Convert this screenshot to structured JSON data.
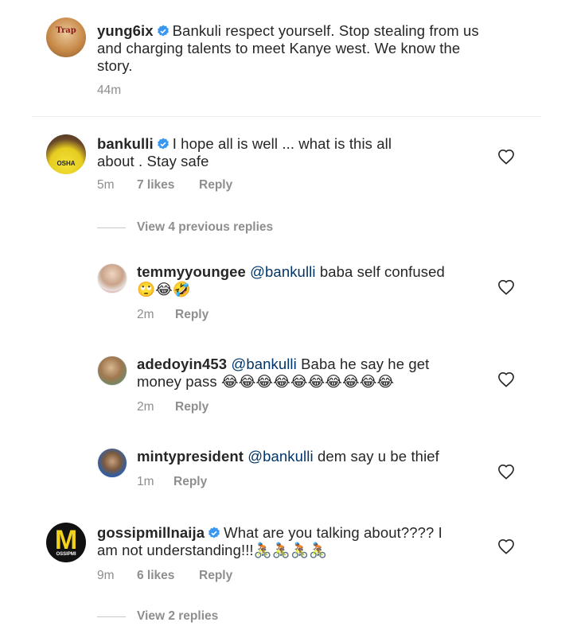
{
  "comments": [
    {
      "username": "yung6ix",
      "text": "Bankuli respect yourself. Stop stealing from us",
      "text2": "and charging talents to meet  Kanye west. We know the",
      "text3": "story.",
      "time": "44m"
    },
    {
      "username": "bankulli",
      "text": "I hope all is well ... what is this all",
      "text2": "about . Stay safe",
      "time": "5m",
      "likes": "7 likes",
      "reply": "Reply"
    }
  ],
  "view_previous": "View 4 previous replies",
  "replies": [
    {
      "username": "temmyyoungee",
      "mention": "@bankulli",
      "text": "baba self confused",
      "emoji": "🙄😂🤣",
      "time": "2m",
      "reply": "Reply"
    },
    {
      "username": "adedoyin453",
      "mention": "@bankulli",
      "text": "Baba he say he get",
      "text2": "money pass",
      "emoji": "😂😂😂😂😂😂😂😂😂😂",
      "time": "2m",
      "reply": "Reply"
    },
    {
      "username": "mintypresident",
      "mention": "@bankulli",
      "text": "dem say u be thief",
      "time": "1m",
      "reply": "Reply"
    }
  ],
  "gossip": {
    "username": "gossipmillnaija",
    "text": "What are you talking about???? I",
    "text2": "am not understanding!!!",
    "emoji": "🚴🏾🚴🏾🚴🏾🚴🏾",
    "time": "9m",
    "likes": "6 likes",
    "reply": "Reply",
    "avatar_letter": "M",
    "avatar_caption": "OSSIPMI"
  },
  "view_more": "View 2 replies",
  "avatar_labels": {
    "yung6ix": "Trap",
    "bankulli": "OSHA"
  },
  "colors": {
    "verified": "#3897f0",
    "mention": "#003569",
    "meta": "#8e8e8e"
  },
  "icons": {
    "heart": "heart-outline-icon",
    "verified": "verified-badge-icon"
  }
}
